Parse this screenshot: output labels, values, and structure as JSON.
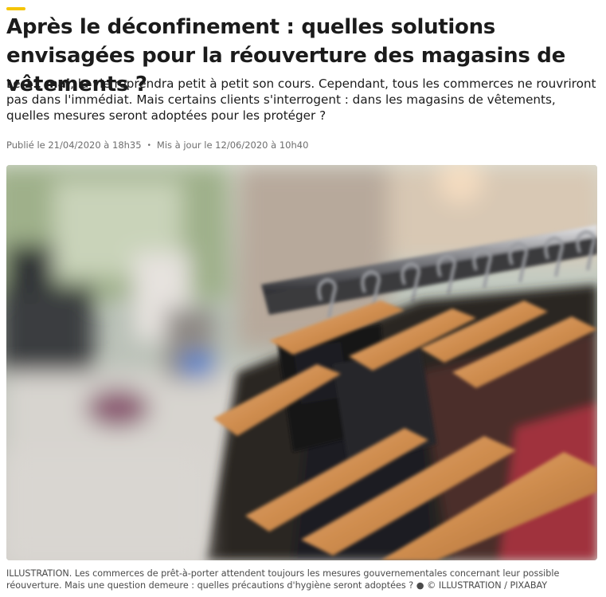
{
  "article": {
    "title": "Après le déconfinement : quelles solutions envisagées pour la réouverture des magasins de vêtements ?",
    "lede_date": "11 mai",
    "lede_intro": "Le ",
    "lede_rest": ", la vie reprendra petit à petit son cours. Cependant, tous les commerces ne rouvriront pas dans l'immédiat. Mais certains clients s'interrogent : dans les magasins de vêtements, quelles mesures seront adoptées pour les protéger ?",
    "published": "Publié le 21/04/2020 à 18h35",
    "updated": "Mis à jour le 12/06/2020 à 10h40",
    "meta_separator": "•",
    "accent_color": "#f5c400"
  },
  "figure": {
    "caption": "ILLUSTRATION. Les commerces de prêt-à-porter attendent toujours les mesures gouvernementales concernant leur possible réouverture. Mais une question demeure : quelles précautions d'hygiène seront adoptées ? ● © ILLUSTRATION / PIXABAY"
  }
}
